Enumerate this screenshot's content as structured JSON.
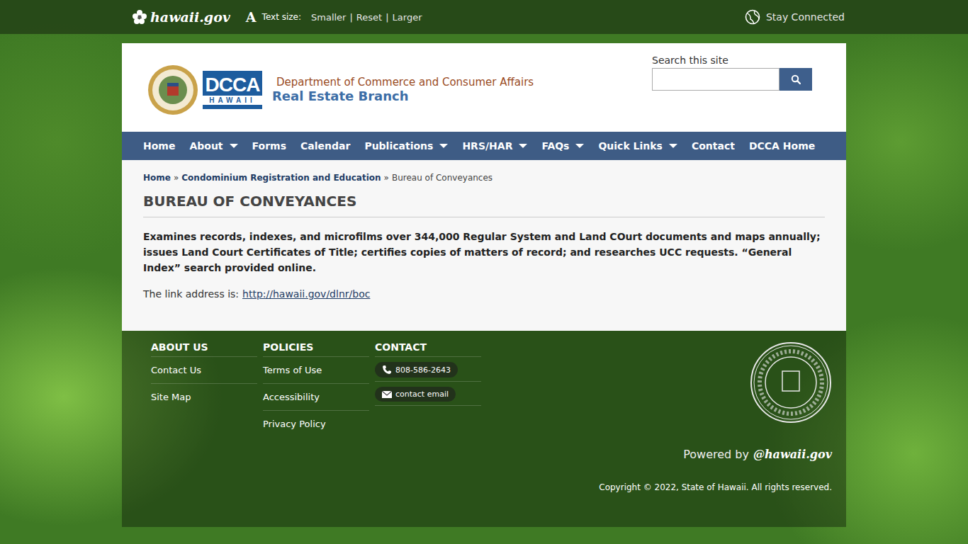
{
  "topbar": {
    "logo": "hawaii.gov",
    "text_size_label": "Text size:",
    "text_size_icon": "A",
    "text_size_options": [
      "Smaller",
      "Reset",
      "Larger"
    ],
    "separator": "|",
    "stay_connected": "Stay Connected"
  },
  "header": {
    "logo_text": "DCCA",
    "logo_subtext": "HAWAII",
    "department": "Department of Commerce and Consumer Affairs",
    "branch": "Real Estate Branch",
    "search_label": "Search this site",
    "search_placeholder": ""
  },
  "nav": [
    {
      "label": "Home",
      "has_menu": false
    },
    {
      "label": "About",
      "has_menu": true
    },
    {
      "label": "Forms",
      "has_menu": false
    },
    {
      "label": "Calendar",
      "has_menu": false
    },
    {
      "label": "Publications",
      "has_menu": true
    },
    {
      "label": "HRS/HAR",
      "has_menu": true
    },
    {
      "label": "FAQs",
      "has_menu": true
    },
    {
      "label": "Quick Links",
      "has_menu": true
    },
    {
      "label": "Contact",
      "has_menu": false
    },
    {
      "label": "DCCA Home",
      "has_menu": false
    }
  ],
  "breadcrumb": {
    "separator": "»",
    "items": [
      {
        "label": "Home",
        "link": true
      },
      {
        "label": "Condominium Registration and Education",
        "link": true
      },
      {
        "label": "Bureau of Conveyances",
        "link": false
      }
    ]
  },
  "page": {
    "title": "BUREAU OF CONVEYANCES",
    "description": "Examines records, indexes, and microfilms over 344,000 Regular System and Land COurt documents and maps annually; issues Land Court Certificates of Title; certifies copies of matters of record; and researches UCC requests. “General Index” search provided online.",
    "link_prefix": "The link address is:",
    "link": "http://hawaii.gov/dlnr/boc"
  },
  "footer": {
    "columns": [
      {
        "heading": "ABOUT US",
        "items": [
          "Contact Us",
          "Site Map"
        ]
      },
      {
        "heading": "POLICIES",
        "items": [
          "Terms of Use",
          "Accessibility",
          "Privacy Policy"
        ]
      }
    ],
    "contact": {
      "heading": "CONTACT",
      "phone": "808-586-2643",
      "email": "contact email"
    },
    "powered_by": "Powered by",
    "powered_logo": "@hawaii.gov",
    "copyright": "Copyright © 2022, State of Hawaii. All rights reserved."
  }
}
